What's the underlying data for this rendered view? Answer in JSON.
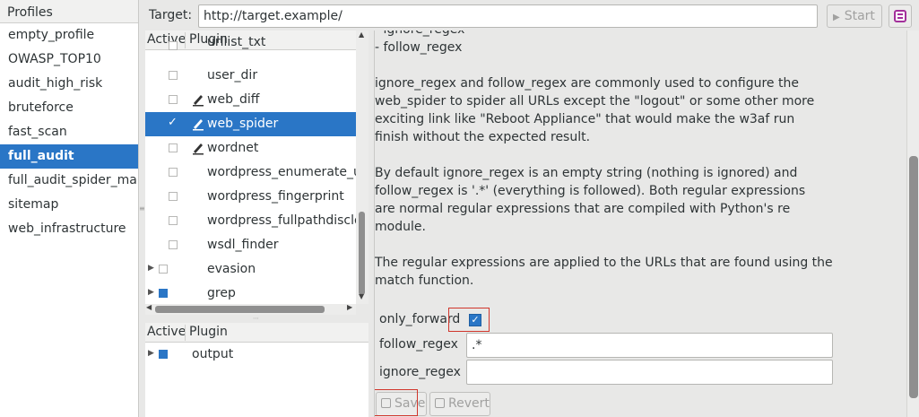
{
  "profiles": {
    "header": "Profiles",
    "items": [
      {
        "label": "empty_profile"
      },
      {
        "label": "OWASP_TOP10"
      },
      {
        "label": "audit_high_risk"
      },
      {
        "label": "bruteforce"
      },
      {
        "label": "fast_scan"
      },
      {
        "label": "full_audit"
      },
      {
        "label": "full_audit_spider_man"
      },
      {
        "label": "sitemap"
      },
      {
        "label": "web_infrastructure"
      }
    ],
    "selected": "full_audit"
  },
  "target": {
    "label": "Target:",
    "value": "http://target.example/",
    "start_label": "Start"
  },
  "plugins_tree": {
    "col_active": "Active",
    "col_plugin": "Plugin",
    "rows": [
      {
        "label": "urllist_txt",
        "checked": false
      },
      {
        "label": "user_dir",
        "checked": false
      },
      {
        "label": "web_diff",
        "checked": false,
        "configurable": true
      },
      {
        "label": "web_spider",
        "checked": true,
        "configurable": true,
        "selected": true
      },
      {
        "label": "wordnet",
        "checked": false,
        "configurable": true
      },
      {
        "label": "wordpress_enumerate_us",
        "checked": false
      },
      {
        "label": "wordpress_fingerprint",
        "checked": false
      },
      {
        "label": "wordpress_fullpathdisclos",
        "checked": false
      },
      {
        "label": "wsdl_finder",
        "checked": false
      },
      {
        "label": "evasion",
        "checked": false,
        "expandable": true
      },
      {
        "label": "grep",
        "checked": "partial",
        "expandable": true
      }
    ]
  },
  "output_tree": {
    "col_active": "Active",
    "col_plugin": "Plugin",
    "rows": [
      {
        "label": "output",
        "checked": "partial",
        "expandable": true
      }
    ]
  },
  "description": {
    "lines_top": [
      "  - ignore_regex",
      "  - follow_regex"
    ],
    "para1": [
      "ignore_regex and follow_regex are commonly used to configure the",
      "web_spider to spider all URLs except the \"logout\" or some other more",
      "exciting link like \"Reboot Appliance\" that would make the w3af run",
      "finish without the expected result."
    ],
    "para2": [
      "By default ignore_regex is an empty string (nothing is ignored) and",
      "follow_regex is '.*' (everything is followed). Both regular expressions",
      "are normal regular expressions that are compiled with Python's re",
      "module."
    ],
    "para3": [
      "The regular expressions are applied to the URLs that are found using the",
      "match function."
    ]
  },
  "options": {
    "only_forward_label": "only_forward",
    "only_forward_checked": true,
    "follow_regex_label": "follow_regex",
    "follow_regex_value": ".*",
    "ignore_regex_label": "ignore_regex",
    "ignore_regex_value": "",
    "save_label": "Save",
    "revert_label": "Revert"
  },
  "colors": {
    "selection": "#2a76c6",
    "highlight_box": "#d0352b"
  }
}
